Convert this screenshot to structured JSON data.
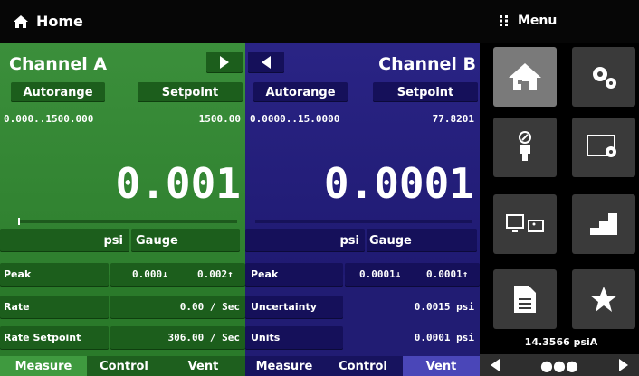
{
  "header": {
    "title": "Home",
    "menu": "Menu"
  },
  "channel_a": {
    "title": "Channel A",
    "autorange": "Autorange",
    "setpoint": "Setpoint",
    "range": "0.000..1500.000",
    "setpoint_value": "1500.00",
    "value": "0.001",
    "units": "psi",
    "mode": "Gauge",
    "rows": [
      {
        "label": "Peak",
        "v1": "0.000↓",
        "v2": "0.002↑"
      },
      {
        "label": "Rate",
        "v1": "0.00 / Sec"
      },
      {
        "label": "Rate Setpoint",
        "v1": "306.00 / Sec"
      }
    ],
    "tabs": [
      "Measure",
      "Control",
      "Vent"
    ]
  },
  "channel_b": {
    "title": "Channel B",
    "autorange": "Autorange",
    "setpoint": "Setpoint",
    "range": "0.0000..15.0000",
    "setpoint_value": "77.8201",
    "value": "0.0001",
    "units": "psi",
    "mode": "Gauge",
    "rows": [
      {
        "label": "Peak",
        "v1": "0.0001↓",
        "v2": "0.0001↑"
      },
      {
        "label": "Uncertainty",
        "v1": "0.0015 psi"
      },
      {
        "label": "Units",
        "v1": "0.0001 psi"
      }
    ],
    "tabs": [
      "Measure",
      "Control",
      "Vent"
    ]
  },
  "menu": {
    "status": "14.3566 psiA",
    "nav_middle": "●●●"
  }
}
